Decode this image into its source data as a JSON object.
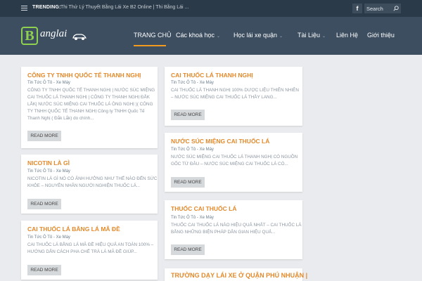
{
  "topbar": {
    "trending_label": "TRENDING:",
    "trending_text": "Thi Thử Lý Thuyết Bằng Lái Xe B2 Online | Thi Bằng Lái ...",
    "facebook_label": "f",
    "search_placeholder": "Search"
  },
  "header": {
    "logo_letter": "B",
    "logo_text": "anglai"
  },
  "nav": {
    "items": [
      {
        "label": "Trang chủ"
      },
      {
        "label": "Các khoá học"
      },
      {
        "label": "Học lái xe quận"
      },
      {
        "label": "Tài Liệu"
      },
      {
        "label": "Liên Hệ"
      },
      {
        "label": "Giới thiệu"
      }
    ]
  },
  "posts": [
    {
      "title": "CÔNG TY TNHH QUỐC TẾ THANH NGHỊ",
      "meta": "Tin Tức Ô Tô - Xe Máy",
      "excerpt": [
        "CÔNG TY TNHH QUỐC TẾ THANH NGHỊ | NƯỚC SÚC MIỆNG",
        "CAI THUỐC LÁ THANH NGHỊ | CÔNG TY THANH NGHỊ ĐẮK",
        "LẮK| NƯỚC SÚC MIỆNG CAI THUỐC LÁ ÔNG NGHỊ )( CÔNG",
        "TY TNHH QUỐC TẾ THANH NGHỊ Công ty TNHH Quốc Tế",
        "Thanh Nghị ( Đắk Lắk) do chính..."
      ],
      "read_more": "READ MORE"
    },
    {
      "title": "Nicotin là gì",
      "meta": "Tin Tức Ô Tô - Xe Máy",
      "excerpt": [
        "NICOTIN LÀ GÌ NÓ CÓ ẢNH HƯỞNG NHƯ THẾ NÀO ĐẾN SỨC",
        "KHỎE – NGUYÊN NHÂN NGƯỜI NGHIỆN THUỐC LÁ..."
      ],
      "read_more": "READ MORE"
    },
    {
      "title": "Cai thuốc lá bằng lá mã đề",
      "meta": "Tin Tức Ô Tô - Xe Máy",
      "excerpt": [
        "CAI THUỐC LÁ BẰNG LÁ MÃ ĐỀ HIỆU QUẢ AN TOÀN 100% –",
        "HƯỚNG DẪN CÁCH PHA CHẾ TRÀ LÁ MÃ ĐỀ GIÚP..."
      ],
      "read_more": "READ MORE"
    },
    {
      "title": "Cai thuốc lá Thanh Nghị",
      "meta": "Tin Tức Ô Tô - Xe Máy",
      "excerpt": [
        "CAI THUỐC LÁ THANH NGHỊ 100% DƯỢC LIỆU THIÊN NHIÊN",
        "– NƯỚC SÚC MIỆNG CAI THUỐC LÁ THẦY LANG..."
      ],
      "read_more": "READ MORE"
    },
    {
      "title": "Nước súc miệng cai thuốc lá",
      "meta": "Tin Tức Ô Tô - Xe Máy",
      "excerpt": [
        "NƯỚC SÚC MIỆNG CAI THUỐC LÁ THANH NGHỊ CÓ NGUỒN",
        "GỐC TỪ ĐÂU – NƯỚC SÚC MIỆNG CAI THUỐC LÁ CÓ..."
      ],
      "read_more": "READ MORE"
    },
    {
      "title": "Thuốc cai thuốc lá",
      "meta": "Tin Tức Ô Tô - Xe Máy",
      "excerpt": [
        "THUỐC CAI THUỐC LÁ NÀO HIỆU QUẢ NHẤT – CAI THUỐC LÁ",
        "BẰNG NHỮNG BIỆN PHÁP DÂN GIAN HIỆU QUẢ..."
      ],
      "read_more": "READ MORE"
    },
    {
      "title": "Trường dạy lái xe ở quận Phú Nhuận |"
    }
  ],
  "colors": {
    "topbar_bg": "#2b3a48",
    "header_bg": "#3c4e60",
    "accent": "#f39b1f",
    "title": "#e3892a",
    "page_bg": "#e9ebee"
  }
}
